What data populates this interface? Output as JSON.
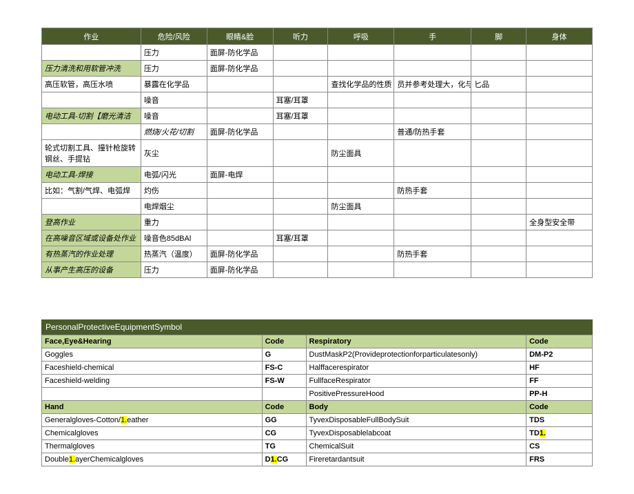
{
  "table1": {
    "headers": [
      "作业",
      "危险/风险",
      "眼睛&脸",
      "听力",
      "呼吸",
      "手",
      "脚",
      "身体"
    ],
    "rows": [
      {
        "c": [
          "",
          "压力",
          "面屏-防化学品",
          "",
          "",
          "",
          "",
          ""
        ]
      },
      {
        "c": [
          "压力清洗和用软管冲洗",
          "压力",
          "面屏-防化学品",
          "",
          "",
          "",
          "",
          ""
        ],
        "greenCols": [
          0
        ]
      },
      {
        "c": [
          "高压软管，高压水喷",
          "暴露在化学品",
          "",
          "",
          "查找化学品的性质",
          "员并参考处理大，化与",
          "匕品",
          ""
        ]
      },
      {
        "c": [
          "",
          "噪音",
          "",
          "耳塞/耳罩",
          "",
          "",
          "",
          ""
        ]
      },
      {
        "c": [
          "电动工具-切割【磨光清洁",
          "噪音",
          "",
          "耳塞/耳罩",
          "",
          "",
          "",
          ""
        ],
        "greenCols": [
          0
        ]
      },
      {
        "c": [
          "",
          "燃烧/火花/切割",
          "面屏-防化学品",
          "",
          "",
          "普通/防热手套",
          "",
          ""
        ],
        "italicCols": [
          1
        ]
      },
      {
        "c": [
          "轮式切割工具、撞针枪旋转钢丝、手提钻",
          "灰尘",
          "",
          "",
          "防尘面具",
          "",
          "",
          ""
        ],
        "tall": true
      },
      {
        "c": [
          "电动工具-焊接",
          "电弧/闪光",
          "面屏-电焊",
          "",
          "",
          "",
          "",
          ""
        ],
        "greenCols": [
          0
        ]
      },
      {
        "c": [
          "比如：气割/气焊、电弧焊",
          "灼伤",
          "",
          "",
          "",
          "防热手套",
          "",
          ""
        ]
      },
      {
        "c": [
          "",
          "电焊烟尘",
          "",
          "",
          "防尘面具",
          "",
          "",
          ""
        ]
      },
      {
        "c": [
          "登高作业",
          "重力",
          "",
          "",
          "",
          "",
          "",
          "全身型安全带"
        ],
        "greenCols": [
          0
        ]
      },
      {
        "c": [
          "在高噪音区域或设备处作业",
          "噪音色85dBAl",
          "",
          "耳塞/耳罩",
          "",
          "",
          "",
          ""
        ],
        "greenCols": [
          0
        ]
      },
      {
        "c": [
          "有热蒸汽的作业处理",
          "热蒸汽（温度）",
          "面屏-防化学品",
          "",
          "",
          "防热手套",
          "",
          ""
        ],
        "greenCols": [
          0
        ]
      },
      {
        "c": [
          "从事产生高压的设备",
          "压力",
          "面屏-防化学品",
          "",
          "",
          "",
          "",
          ""
        ],
        "greenCols": [
          0
        ]
      }
    ]
  },
  "title2": "PersonalProtectiveEquipmentSymbol",
  "table2": {
    "sub1": {
      "l": "Face,Eye&Hearing",
      "lc": "Code",
      "r": "Respiratory",
      "rc": "Code"
    },
    "rows1": [
      {
        "l": "Goggles",
        "lc": "G",
        "r": "DustMaskP2(Provideprotectionforparticulatesonly)",
        "rc": "DM-P2"
      },
      {
        "l": "Faceshield-chemical",
        "lc": "FS-C",
        "r": "Halffacerespirator",
        "rc": "HF"
      },
      {
        "l": "Faceshield-welding",
        "lc": "FS-W",
        "r": "FullfaceRespirator",
        "rc": "FF"
      },
      {
        "l": "",
        "lc": "",
        "r": "PositivePressureHood",
        "rc": "PP-H"
      }
    ],
    "sub2": {
      "l": "Hand",
      "lc": "Code",
      "r": "Body",
      "rc": "Code"
    },
    "rows2": [
      {
        "l_pre": "Generalgloves-Cotton/",
        "l_hl": "1.",
        "l_post": "eather",
        "lc": "GG",
        "r": "TyvexDisposableFullBodySuit",
        "rc": "TDS"
      },
      {
        "l": "Chemicalgloves",
        "lc": "CG",
        "r": "TyvexDisposablelabcoat",
        "rc_pre": "TD",
        "rc_hl": "1."
      },
      {
        "l": "Thermalgloves",
        "lc": "TG",
        "r": "ChemicalSuit",
        "rc": "CS"
      },
      {
        "l_pre": "Double",
        "l_hl": "1.",
        "l_post": "ayerChemicalgloves",
        "lc_pre": "D",
        "lc_hl": "1.",
        "lc_post": "CG",
        "r": "Fireretardantsuit",
        "rc": "FRS"
      }
    ]
  }
}
